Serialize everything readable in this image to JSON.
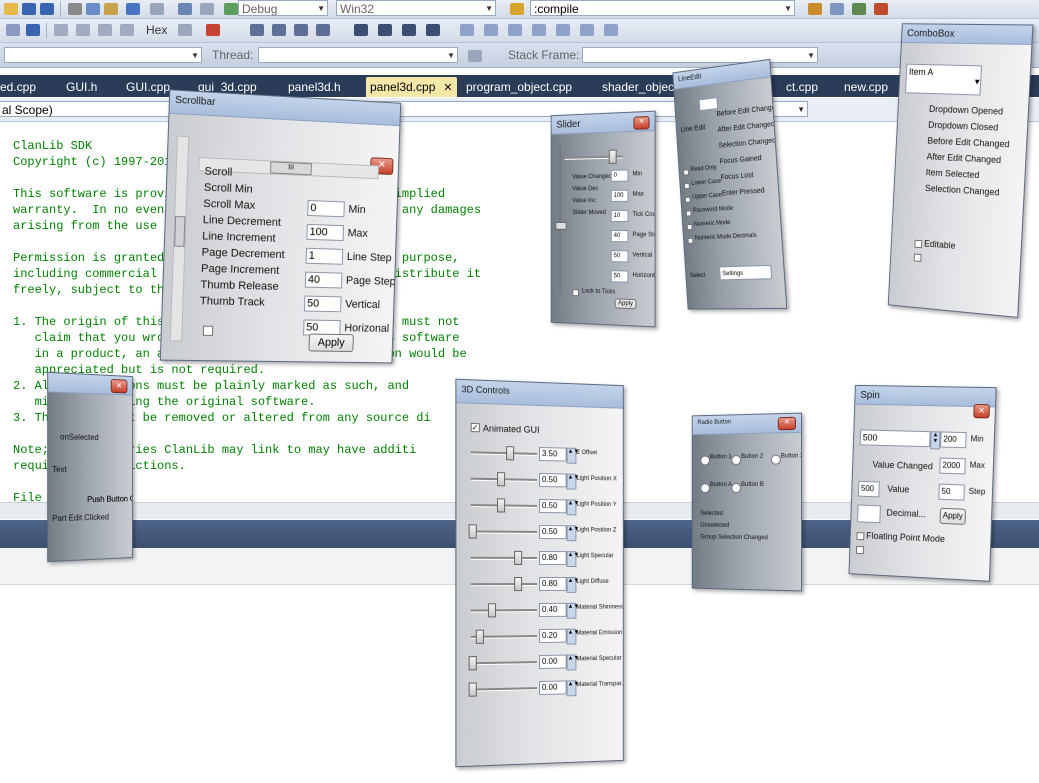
{
  "toolbar": {
    "hex_label": "Hex",
    "config_combo": "Debug",
    "platform_combo": "Win32",
    "find_combo": ":compile",
    "thread_label": "Thread:",
    "stack_frame_label": "Stack Frame:"
  },
  "tabs": [
    {
      "label": "ed.cpp"
    },
    {
      "label": "GUI.h"
    },
    {
      "label": "GUI.cpp"
    },
    {
      "label": "gui_3d.cpp"
    },
    {
      "label": "panel3d.h"
    },
    {
      "label": "panel3d.cpp",
      "active": true
    },
    {
      "label": "program_object.cpp"
    },
    {
      "label": "shader_object.h"
    },
    {
      "label": "ct.cpp"
    },
    {
      "label": "new.cpp"
    }
  ],
  "active_tab_close": "✕",
  "scope_combo": "al Scope)",
  "code_lines": [
    "ClanLib SDK",
    "Copyright (c) 1997-201",
    "",
    "This software is provi                            or implied",
    "warranty.  In no event                            for any damages",
    "arising from the use o",
    "",
    "Permission is granted                             any purpose,",
    "including commercial a                            redistribute it",
    "freely, subject to the",
    "",
    "1. The origin of this                         ed; you must not",
    "   claim that you wrot                        se this software",
    "   in a product, an ac                        entation would be",
    "   appreciated but is not required.",
    "2. Al      versions must be plainly marked as such, and ",
    "   mi      as being the original software.",
    "3. Th       y not be removed or altered from any source di",
    "",
    "Note;      libraries ClanLib may link to may have additi",
    "requi       estrictions.",
    "",
    "File"
  ],
  "scrollbar_panel": {
    "title": "Scrollbar",
    "events": [
      "Scroll",
      "Scroll Min",
      "Scroll Max",
      "Line Decrement",
      "Line Increment",
      "Page Decrement",
      "Page Increment",
      "Thumb Release",
      "Thumb Track"
    ],
    "fields": [
      {
        "value": "0",
        "label": "Min"
      },
      {
        "value": "100",
        "label": "Max"
      },
      {
        "value": "1",
        "label": "Line Step"
      },
      {
        "value": "40",
        "label": "Page Step"
      },
      {
        "value": "50",
        "label": "Vertical"
      },
      {
        "value": "50",
        "label": "Horizonal"
      }
    ],
    "apply": "Apply",
    "hscroll_thumb": "III"
  },
  "slider_panel": {
    "title": "Slider",
    "events": [
      "Value Changed",
      "Value Dec",
      "Value Inc",
      "Slider Moved"
    ],
    "fields": [
      {
        "value": "0",
        "label": "Min"
      },
      {
        "value": "100",
        "label": "Max"
      },
      {
        "value": "10",
        "label": "Tick Count"
      },
      {
        "value": "40",
        "label": "Page Step"
      },
      {
        "value": "50",
        "label": "Vertical"
      },
      {
        "value": "50",
        "label": "Horizonta"
      }
    ],
    "lock": "Lock to Ticks",
    "apply": "Apply"
  },
  "lineedit_panel": {
    "title": "LineEdit",
    "field_label": "Line Edit",
    "options": [
      "Read Only",
      "Lower Case",
      "Upper Case",
      "Password Mode",
      "Numeric Mode",
      "Numeric Mode Decimals"
    ],
    "events": [
      "Before Edit Changed",
      "After Edit Changed",
      "Selection Changed",
      "Focus Gained",
      "Focus Lost",
      "Enter Pressed"
    ],
    "bottom_label": "Select",
    "bottom_combo": "Settings"
  },
  "combobox_panel": {
    "title": "ComboBox",
    "selected": "Item A",
    "events": [
      "Dropdown Opened",
      "Dropdown Closed",
      "Before Edit Changed",
      "After Edit Changed",
      "Item Selected",
      "Selection Changed"
    ],
    "editable": "Editable"
  },
  "pushbutton_panel": {
    "labels": [
      "onSelected",
      "Text",
      "Push Button Clicked",
      "Part Edit Clicked"
    ]
  },
  "controls3d_panel": {
    "title": "3D Controls",
    "animated": "Animated GUI",
    "rows": [
      {
        "value": "3.50",
        "label": "Z Offset",
        "pos": 0.6
      },
      {
        "value": "0.50",
        "label": "Light Position X",
        "pos": 0.45
      },
      {
        "value": "0.50",
        "label": "Light Position Y",
        "pos": 0.45
      },
      {
        "value": "0.50",
        "label": "Light Position Z",
        "pos": 0.0
      },
      {
        "value": "0.80",
        "label": "Light Specular",
        "pos": 0.72
      },
      {
        "value": "0.80",
        "label": "Light Diffuse",
        "pos": 0.72
      },
      {
        "value": "0.40",
        "label": "Material Shininess",
        "pos": 0.3
      },
      {
        "value": "0.20",
        "label": "Material Emission",
        "pos": 0.12
      },
      {
        "value": "0.00",
        "label": "Material Specular",
        "pos": 0.0
      },
      {
        "value": "0.00",
        "label": "Material Transpar...",
        "pos": 0.0
      }
    ]
  },
  "radiobutton_panel": {
    "title": "Radio Button",
    "radios": [
      "Button 1",
      "Button 2",
      "Button 3",
      "Button A",
      "Button B"
    ],
    "events": [
      "Selected",
      "Unselected",
      "Group Selection Changed"
    ]
  },
  "spin_panel": {
    "title": "Spin",
    "spin_value": "500",
    "fields": [
      {
        "value": "200",
        "label": "Min"
      },
      {
        "value": "2000",
        "label": "Max"
      },
      {
        "value": "50",
        "label": "Step"
      }
    ],
    "value_changed": "Value Changed",
    "value_field": "500",
    "value_label": "Value",
    "decimal_field": "",
    "decimal_label": "Decimal...",
    "apply": "Apply",
    "floating": "Floating Point Mode"
  }
}
